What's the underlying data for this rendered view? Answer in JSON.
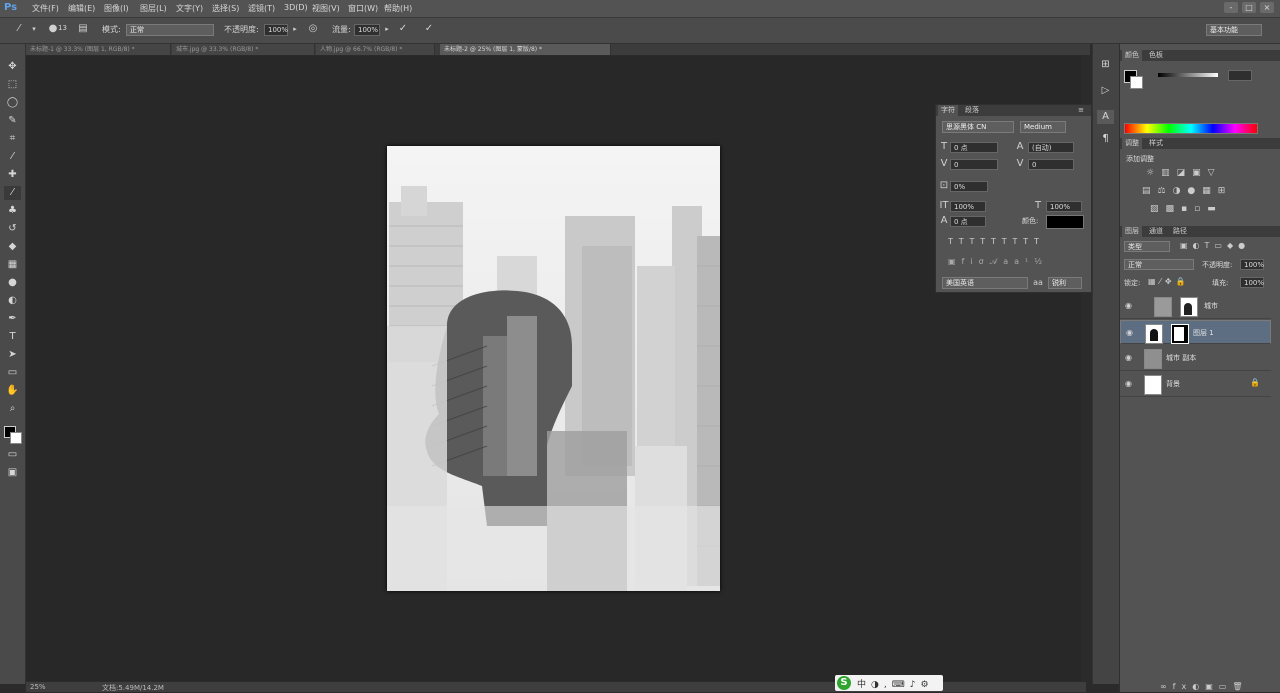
{
  "app": {
    "logo": "Ps"
  },
  "menu": [
    "文件(F)",
    "编辑(E)",
    "图像(I)",
    "图层(L)",
    "文字(Y)",
    "选择(S)",
    "滤镜(T)",
    "3D(D)",
    "视图(V)",
    "窗口(W)",
    "帮助(H)"
  ],
  "window_buttons": [
    "-",
    "□",
    "×"
  ],
  "options": {
    "brush_size": "13",
    "mode_label": "模式:",
    "mode_value": "正常",
    "opacity_label": "不透明度:",
    "opacity_value": "100%",
    "flow_label": "流量:",
    "flow_value": "100%",
    "workspace": "基本功能"
  },
  "doc_tabs": [
    {
      "label": "未标题-1 @ 33.3% (图层 1, RGB/8) *",
      "active": false
    },
    {
      "label": "城市.jpg @ 33.3% (RGB/8) *",
      "active": false
    },
    {
      "label": "人物.jpg @ 66.7% (RGB/8) *",
      "active": false
    },
    {
      "label": "未标题-2 @ 25% (图层 1, 蒙版/8) *",
      "active": true
    }
  ],
  "status": {
    "zoom": "25%",
    "doc": "文档:5.49M/14.2M"
  },
  "character_panel": {
    "tabs": [
      "字符",
      "段落"
    ],
    "font_family": "思源黑体 CN",
    "font_style": "Medium",
    "font_size": "0 点",
    "leading": "(自动)",
    "kerning": "0",
    "tracking": "0",
    "scale_pct": "0%",
    "vscale": "100%",
    "hscale": "100%",
    "baseline": "0 点",
    "color_label": "颜色:",
    "language": "美国英语",
    "aa": "锐利"
  },
  "color_panel": {
    "tabs": [
      "颜色",
      "色板"
    ]
  },
  "adjust_panel": {
    "tabs": [
      "调整",
      "样式"
    ],
    "title": "添加调整"
  },
  "layers_panel": {
    "tabs": [
      "图层",
      "通道",
      "路径"
    ],
    "kind": "类型",
    "blend": "正常",
    "opacity_label": "不透明度:",
    "opacity_value": "100%",
    "lock_label": "锁定:",
    "fill_label": "填充:",
    "fill_value": "100%",
    "layers": [
      {
        "name": "城市",
        "selected": false
      },
      {
        "name": "图层 1",
        "selected": true
      },
      {
        "name": "城市 副本",
        "selected": false
      },
      {
        "name": "背景",
        "selected": false
      }
    ]
  },
  "ime": {
    "label": "S"
  },
  "colors": {
    "accent": "#5fa3e8",
    "panel": "#535353",
    "canvas": "#282828"
  }
}
